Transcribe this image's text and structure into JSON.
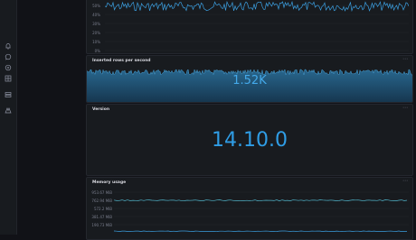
{
  "sidebar": {
    "icons": [
      "bell-icon",
      "chat-icon",
      "compass-icon",
      "dashboard-grid-icon",
      "server-icon",
      "cluster-icon"
    ]
  },
  "cpu_panel": {
    "y_ticks": [
      "50%",
      "40%",
      "30%",
      "20%",
      "10%",
      "0%"
    ]
  },
  "inserted_rows_panel": {
    "title": "Inserted rows per second",
    "value": "1.52K"
  },
  "version_panel": {
    "title": "Version",
    "value": "14.10.0"
  },
  "memory_panel": {
    "title": "Memory usage",
    "y_ticks": [
      "953.67 MiB",
      "762.94 MiB",
      "572.2 MiB",
      "381.47 MiB",
      "190.73 MiB"
    ]
  },
  "colors": {
    "accent": "#3b9fe0",
    "stat_blue": "#2f9de5",
    "line_teal": "#4fb3c8",
    "background": "#111217",
    "panel": "#181b1f"
  }
}
